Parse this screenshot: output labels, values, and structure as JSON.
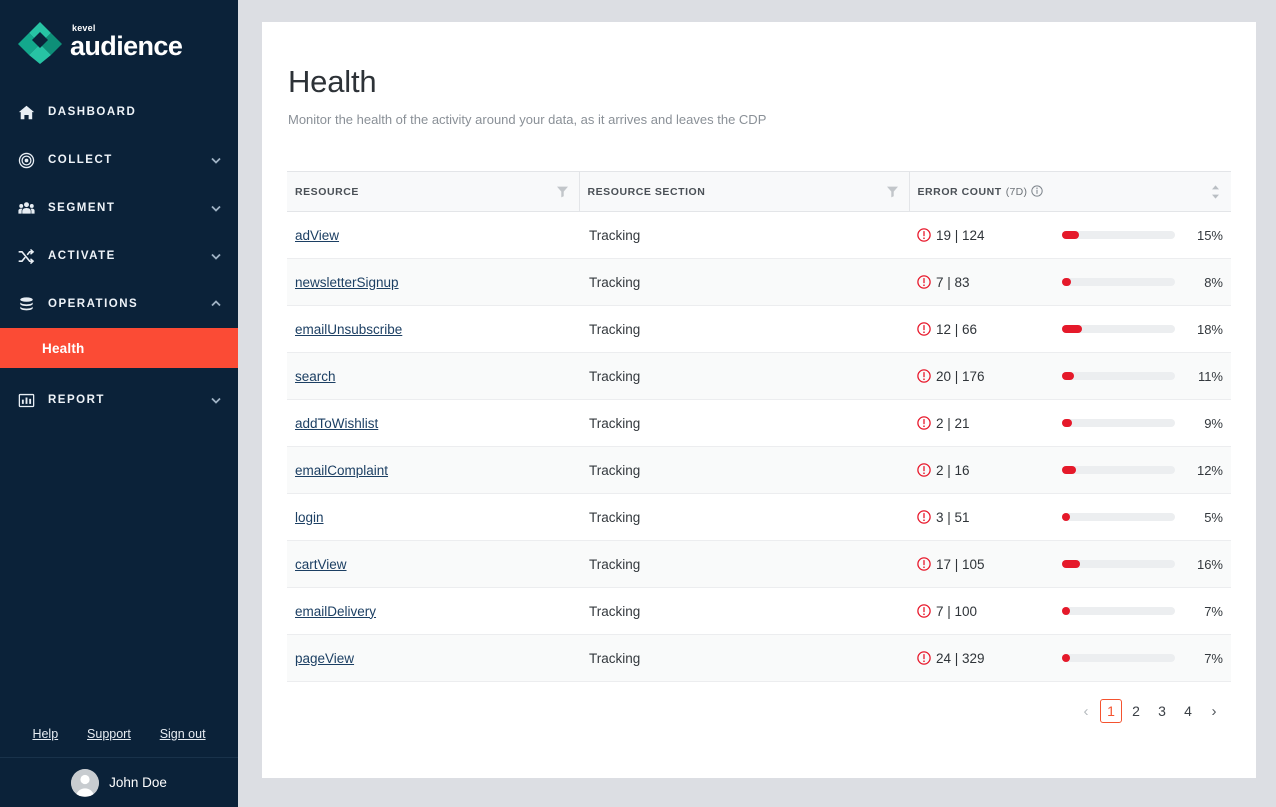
{
  "brand": {
    "logo_top": "kevel",
    "logo_main": "audience",
    "logo_icon": "kevel-diamond-logo",
    "accent_teal": "#17a98f",
    "accent_orange": "#fb4b35",
    "sidebar_bg": "#0b2239",
    "error_red": "#e5192a"
  },
  "sidebar": {
    "items": [
      {
        "label": "DASHBOARD",
        "icon": "home-icon",
        "expandable": false,
        "expanded": false
      },
      {
        "label": "COLLECT",
        "icon": "target-icon",
        "expandable": true,
        "expanded": false
      },
      {
        "label": "SEGMENT",
        "icon": "users-icon",
        "expandable": true,
        "expanded": false
      },
      {
        "label": "ACTIVATE",
        "icon": "shuffle-icon",
        "expandable": true,
        "expanded": false
      },
      {
        "label": "OPERATIONS",
        "icon": "database-icon",
        "expandable": true,
        "expanded": true
      },
      {
        "label": "REPORT",
        "icon": "bar-chart-icon",
        "expandable": true,
        "expanded": false
      }
    ],
    "sub_item": {
      "label": "Health",
      "active": true
    },
    "footer_links": [
      {
        "label": "Help"
      },
      {
        "label": "Support"
      },
      {
        "label": "Sign out"
      }
    ],
    "user": {
      "name": "John Doe",
      "avatar": "user-avatar-icon"
    }
  },
  "page": {
    "title": "Health",
    "subtitle": "Monitor the health of the activity around your data, as it arrives and leaves the CDP"
  },
  "table": {
    "columns": [
      {
        "label": "RESOURCE",
        "sublabel": "",
        "filter": true,
        "sort": false,
        "info": false
      },
      {
        "label": "RESOURCE SECTION",
        "sublabel": "",
        "filter": true,
        "sort": false,
        "info": false
      },
      {
        "label": "ERROR COUNT",
        "sublabel": "(7D)",
        "filter": false,
        "sort": true,
        "info": true
      }
    ],
    "rows": [
      {
        "resource": "adView",
        "section": "Tracking",
        "errors": 19,
        "total": 124,
        "count_text": "19 | 124",
        "percent": 15,
        "percent_text": "15%"
      },
      {
        "resource": "newsletterSignup",
        "section": "Tracking",
        "errors": 7,
        "total": 83,
        "count_text": "7 | 83",
        "percent": 8,
        "percent_text": "8%"
      },
      {
        "resource": "emailUnsubscribe",
        "section": "Tracking",
        "errors": 12,
        "total": 66,
        "count_text": "12 | 66",
        "percent": 18,
        "percent_text": "18%"
      },
      {
        "resource": "search",
        "section": "Tracking",
        "errors": 20,
        "total": 176,
        "count_text": "20 | 176",
        "percent": 11,
        "percent_text": "11%"
      },
      {
        "resource": "addToWishlist",
        "section": "Tracking",
        "errors": 2,
        "total": 21,
        "count_text": "2 | 21",
        "percent": 9,
        "percent_text": "9%"
      },
      {
        "resource": "emailComplaint",
        "section": "Tracking",
        "errors": 2,
        "total": 16,
        "count_text": "2 | 16",
        "percent": 12,
        "percent_text": "12%"
      },
      {
        "resource": "login",
        "section": "Tracking",
        "errors": 3,
        "total": 51,
        "count_text": "3 | 51",
        "percent": 5,
        "percent_text": "5%"
      },
      {
        "resource": "cartView",
        "section": "Tracking",
        "errors": 17,
        "total": 105,
        "count_text": "17 | 105",
        "percent": 16,
        "percent_text": "16%"
      },
      {
        "resource": "emailDelivery",
        "section": "Tracking",
        "errors": 7,
        "total": 100,
        "count_text": "7 | 100",
        "percent": 7,
        "percent_text": "7%"
      },
      {
        "resource": "pageView",
        "section": "Tracking",
        "errors": 24,
        "total": 329,
        "count_text": "24 | 329",
        "percent": 7,
        "percent_text": "7%"
      }
    ]
  },
  "pagination": {
    "prev": "‹",
    "next": "›",
    "pages": [
      "1",
      "2",
      "3",
      "4"
    ],
    "current": "1"
  }
}
